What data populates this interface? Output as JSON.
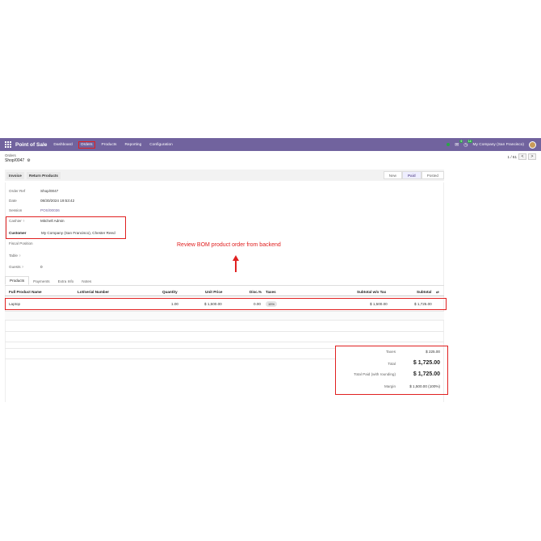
{
  "navbar": {
    "app_title": "Point of Sale",
    "menu": [
      "Dashboard",
      "Orders",
      "Products",
      "Reporting",
      "Configuration"
    ],
    "chat_count": "9",
    "activity_count": "14",
    "company": "My Company (San Francisco)"
  },
  "breadcrumb": {
    "parent": "Orders",
    "current": "Shop/0047"
  },
  "pager": {
    "text": "1 / 61",
    "prev": "<",
    "next": ">"
  },
  "actions": {
    "invoice": "Invoice",
    "return": "Return Products"
  },
  "status": {
    "stages": [
      "New",
      "Paid",
      "Posted"
    ],
    "active": "Paid"
  },
  "fields": {
    "order_ref_label": "Order Ref",
    "order_ref": "Shop/0047",
    "date_label": "Date",
    "date": "08/30/2024 19:53:42",
    "session_label": "Session",
    "session": "POS/00036",
    "cashier_label": "Cashier",
    "cashier": "Mitchell Admin",
    "customer_label": "Customer",
    "customer": "My Company (San Francisco), Chester Reed",
    "fiscal_label": "Fiscal Position",
    "table_label": "Table",
    "guests_label": "Guests",
    "guests": "0",
    "req_mark": "?"
  },
  "annotation": "Review BOM product order from backend",
  "tabs": [
    "Products",
    "Payments",
    "Extra Info",
    "Notes"
  ],
  "table": {
    "headers": [
      "Full Product Name",
      "Lot/serial Number",
      "Quantity",
      "Unit Price",
      "Disc.%",
      "Taxes",
      "Subtotal w/o Tax",
      "Subtotal"
    ],
    "settings_icon": "⇄",
    "rows": [
      {
        "name": "Laptop",
        "lot": "",
        "qty": "1.00",
        "unit_price": "$ 1,500.00",
        "disc": "0.00",
        "taxes": "15%",
        "subtotal_wo_tax": "$ 1,500.00",
        "subtotal": "$ 1,725.00"
      }
    ]
  },
  "totals": {
    "taxes_label": "Taxes",
    "taxes": "$ 225.00",
    "total_label": "Total",
    "total": "$ 1,725.00",
    "paid_label": "Total Paid (with rounding)",
    "paid": "$ 1,725.00",
    "margin_label": "Margin",
    "margin": "$ 1,500.00 (100%)"
  },
  "colors": {
    "navbar": "#71639e",
    "highlight": "#e02020"
  }
}
